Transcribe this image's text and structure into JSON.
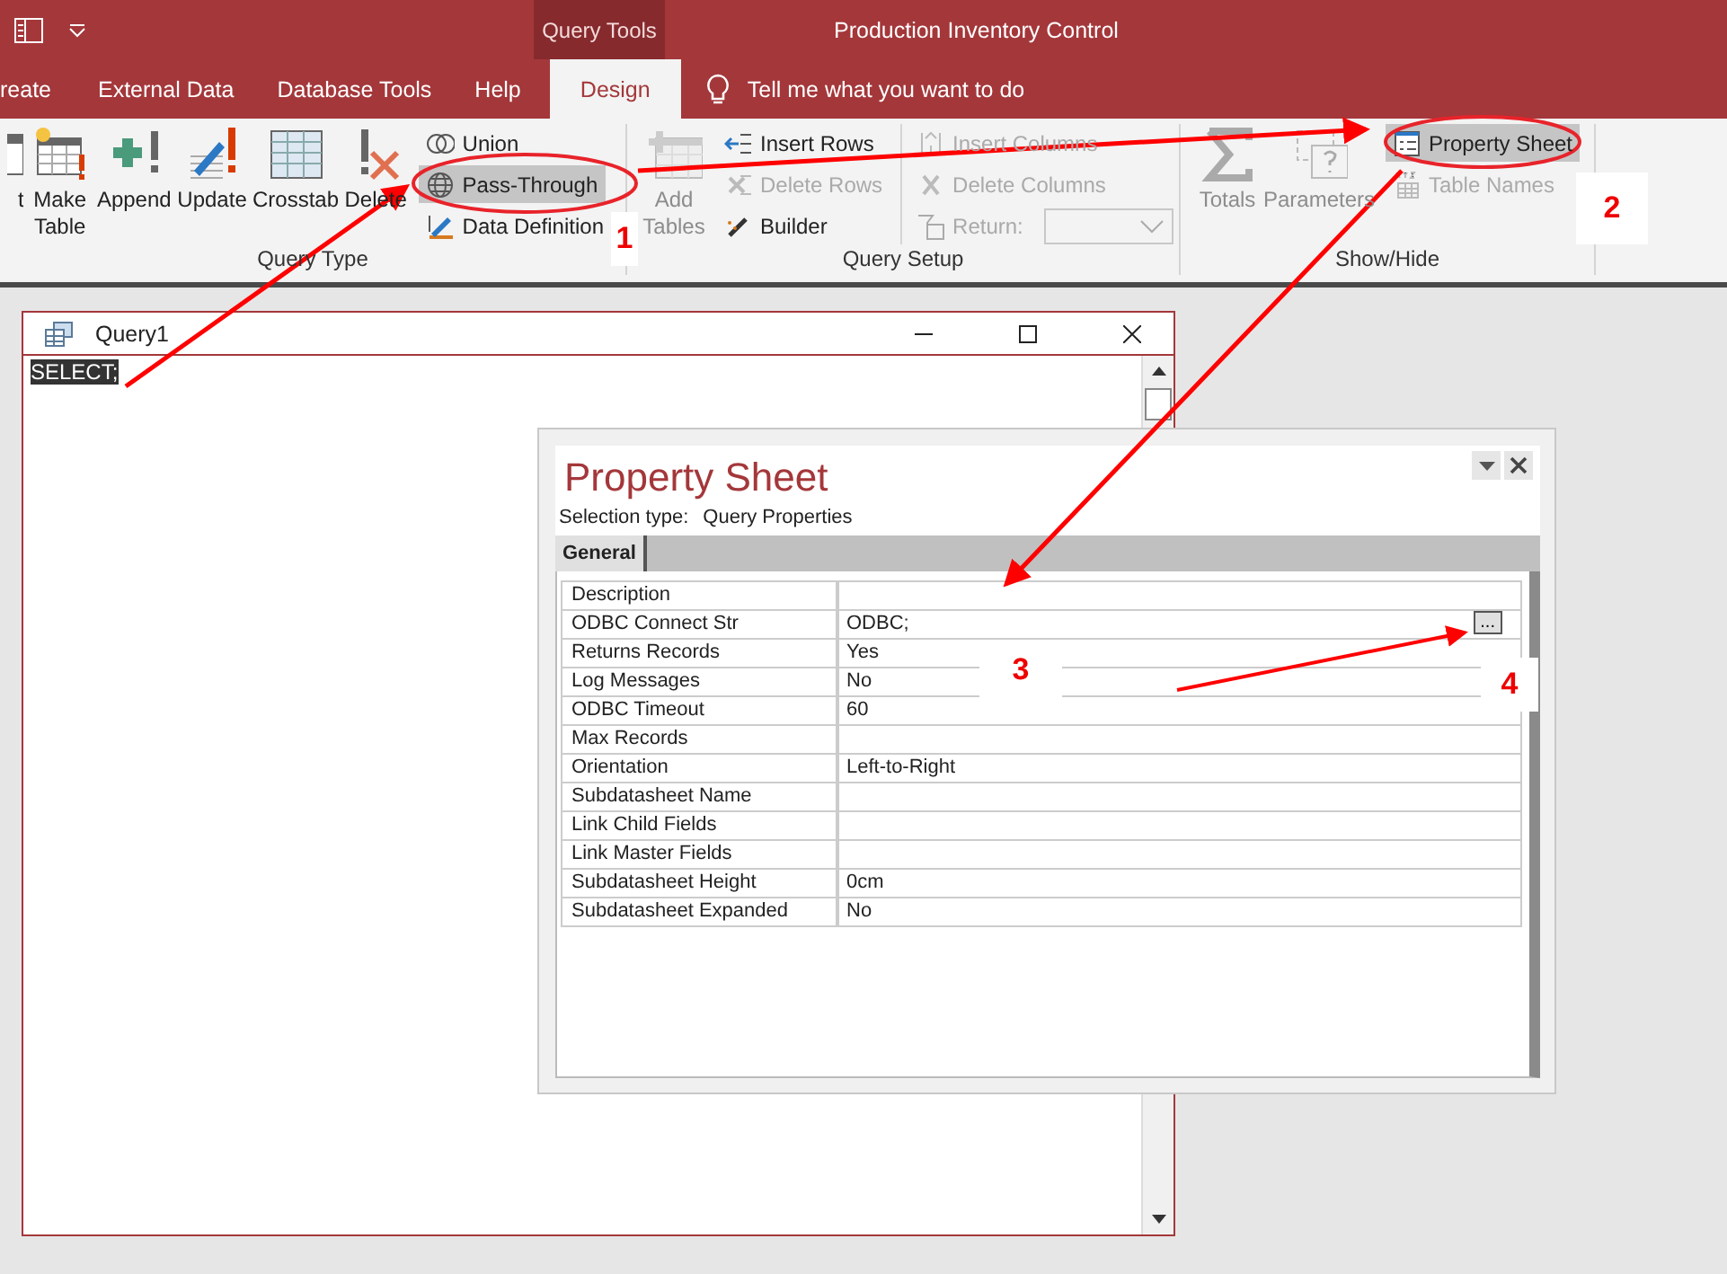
{
  "window": {
    "title": "Production Inventory Control",
    "contextual_group": "Query Tools"
  },
  "tabs": [
    {
      "label": "reate",
      "selected": false
    },
    {
      "label": "External Data",
      "selected": false
    },
    {
      "label": "Database Tools",
      "selected": false
    },
    {
      "label": "Help",
      "selected": false
    },
    {
      "label": "Design",
      "selected": true
    }
  ],
  "tell_me": "Tell me what you want to do",
  "ribbon": {
    "groups": [
      {
        "label": "Query Type",
        "large": [
          {
            "label": "t",
            "disabled": false
          },
          {
            "label": "Make Table",
            "disabled": false
          },
          {
            "label": "Append",
            "disabled": false
          },
          {
            "label": "Update",
            "disabled": false
          },
          {
            "label": "Crosstab",
            "disabled": false
          },
          {
            "label": "Delete",
            "disabled": false
          }
        ],
        "columns": [
          [
            {
              "label": "Union",
              "disabled": false,
              "selected": false
            },
            {
              "label": "Pass-Through",
              "disabled": false,
              "selected": true
            },
            {
              "label": "Data Definition",
              "disabled": false,
              "selected": false
            }
          ]
        ]
      },
      {
        "label": "Query Setup",
        "large": [
          {
            "label": "Add Tables",
            "disabled": true
          }
        ],
        "columns": [
          [
            {
              "label": "Insert Rows",
              "disabled": false,
              "selected": false
            },
            {
              "label": "Delete Rows",
              "disabled": true,
              "selected": false
            },
            {
              "label": "Builder",
              "disabled": false,
              "selected": false
            }
          ],
          [
            {
              "label": "Insert Columns",
              "disabled": true,
              "selected": false
            },
            {
              "label": "Delete Columns",
              "disabled": true,
              "selected": false
            },
            {
              "label": "Return:",
              "disabled": true,
              "selected": false,
              "kind": "combo"
            }
          ]
        ]
      },
      {
        "label": "Show/Hide",
        "large": [
          {
            "label": "Totals",
            "disabled": true
          },
          {
            "label": "Parameters",
            "disabled": true
          }
        ],
        "columns": [
          [
            {
              "label": "Property Sheet",
              "disabled": false,
              "selected": true
            },
            {
              "label": "Table Names",
              "disabled": true,
              "selected": false
            }
          ]
        ]
      }
    ]
  },
  "query_window": {
    "title": "Query1",
    "sql": "SELECT;"
  },
  "property_sheet": {
    "title": "Property Sheet",
    "selection_type_label": "Selection type:",
    "selection_type": "Query Properties",
    "tabs": [
      {
        "label": "General",
        "selected": true
      }
    ],
    "rows": [
      {
        "name": "Description",
        "value": ""
      },
      {
        "name": "ODBC Connect Str",
        "value": "ODBC;",
        "builder_button": "..."
      },
      {
        "name": "Returns Records",
        "value": "Yes"
      },
      {
        "name": "Log Messages",
        "value": "No"
      },
      {
        "name": "ODBC Timeout",
        "value": "60"
      },
      {
        "name": "Max Records",
        "value": ""
      },
      {
        "name": "Orientation",
        "value": "Left-to-Right"
      },
      {
        "name": "Subdatasheet Name",
        "value": ""
      },
      {
        "name": "Link Child Fields",
        "value": ""
      },
      {
        "name": "Link Master Fields",
        "value": ""
      },
      {
        "name": "Subdatasheet Height",
        "value": "0cm"
      },
      {
        "name": "Subdatasheet Expanded",
        "value": "No"
      }
    ]
  },
  "annotations": [
    {
      "label": "1"
    },
    {
      "label": "2"
    },
    {
      "label": "3"
    },
    {
      "label": "4"
    }
  ]
}
